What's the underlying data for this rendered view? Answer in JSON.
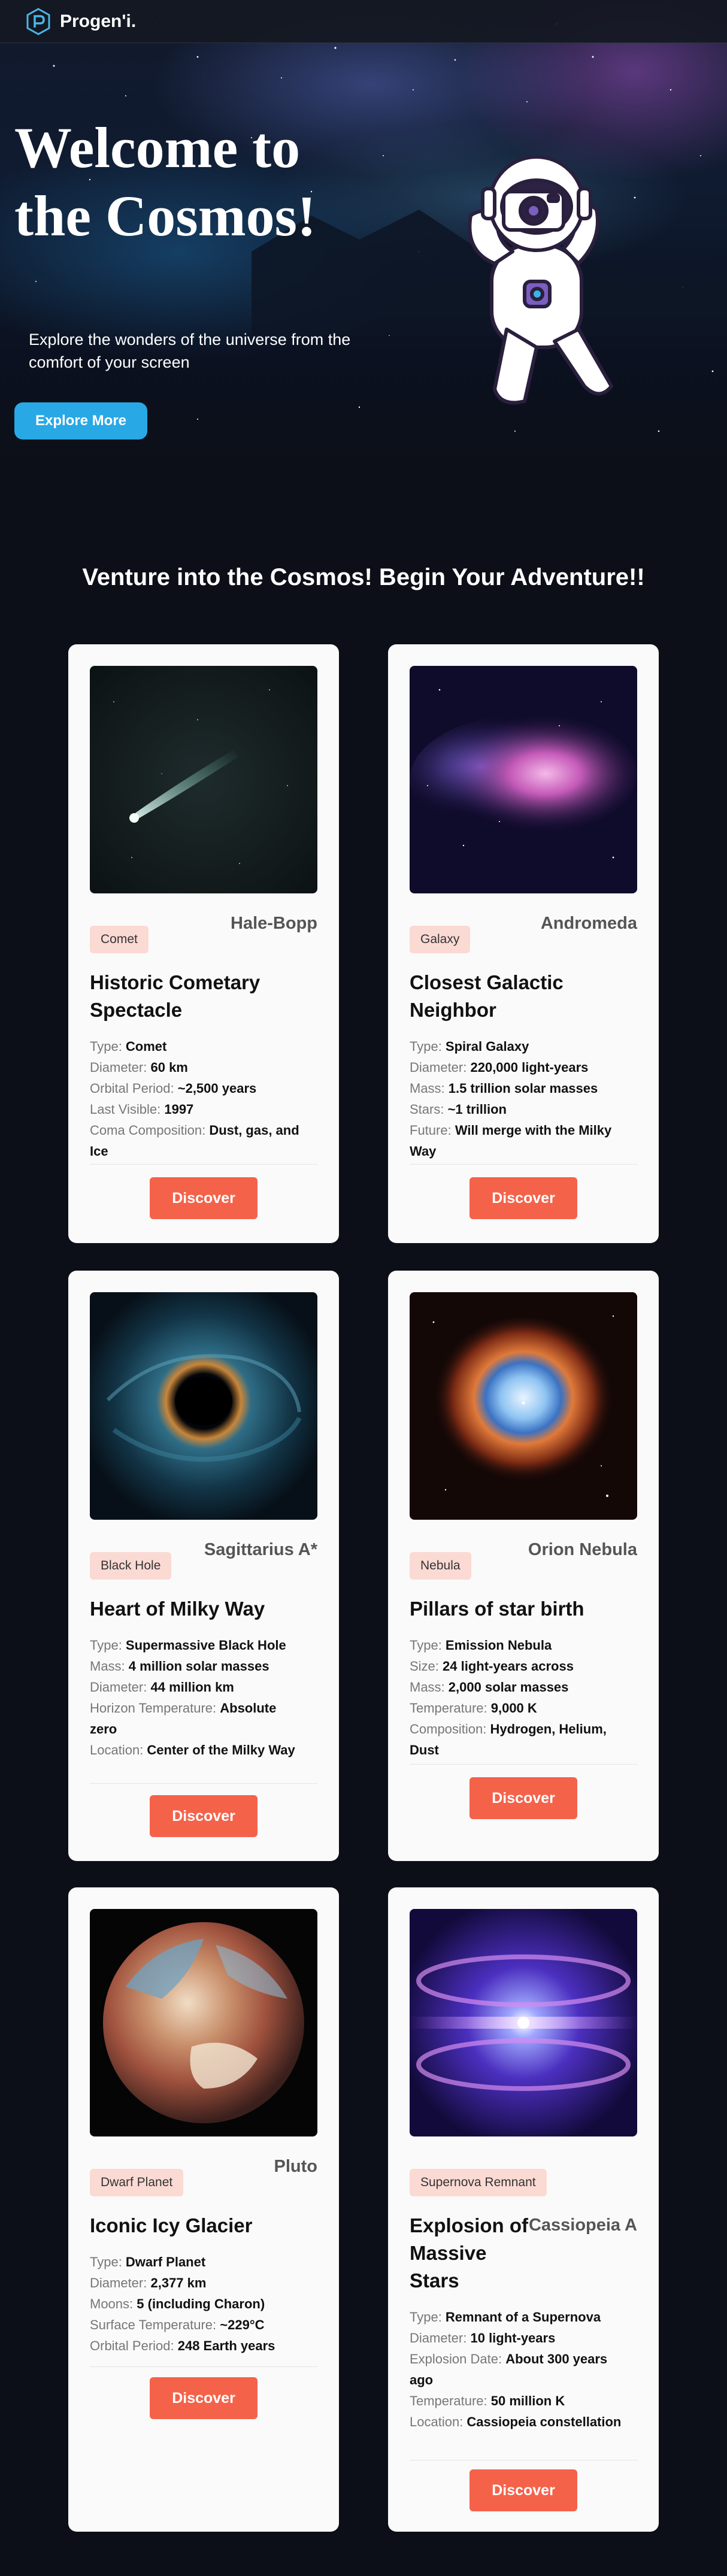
{
  "nav": {
    "logo_text": "Progen'i.",
    "logo_icon": "hexagon-p-logo-icon"
  },
  "hero": {
    "title": "Welcome to the Cosmos!",
    "subtitle": "Explore the wonders of the universe from the comfort of your screen",
    "button_label": "Explore More",
    "astronaut_icon": "astronaut-camera-illustration"
  },
  "section": {
    "title": "Venture into the Cosmos! Begin Your Adventure!!"
  },
  "colors": {
    "accent": "#f4624a",
    "hero_button": "#29a8e6",
    "badge_bg": "#fbdad4",
    "page_bg": "#0c0f17"
  },
  "cards": [
    {
      "name": "Hale-Bopp",
      "badge": "Comet",
      "title": "Historic Cometary Spectacle",
      "details": [
        {
          "label": "Type: ",
          "value": "Comet"
        },
        {
          "label": "Diameter: ",
          "value": "60 km"
        },
        {
          "label": "Orbital Period: ",
          "value": "~2,500 years"
        },
        {
          "label": "Last Visible: ",
          "value": "1997"
        },
        {
          "label": "Coma Composition: ",
          "value": "Dust, gas, and Ice"
        }
      ],
      "button": "Discover"
    },
    {
      "name": "Andromeda",
      "badge": "Galaxy",
      "title": "Closest Galactic Neighbor",
      "details": [
        {
          "label": "Type: ",
          "value": "Spiral Galaxy"
        },
        {
          "label": "Diameter: ",
          "value": "220,000 light-years"
        },
        {
          "label": "Mass: ",
          "value": "1.5 trillion solar masses"
        },
        {
          "label": "Stars: ",
          "value": "~1 trillion"
        },
        {
          "label": "Future: ",
          "value": "Will merge with the Milky Way"
        }
      ],
      "button": "Discover"
    },
    {
      "name": "Sagittarius A*",
      "badge": "Black Hole",
      "title": "Heart of Milky Way",
      "details": [
        {
          "label": "Type: ",
          "value": "Supermassive Black Hole"
        },
        {
          "label": "Mass: ",
          "value": "4 million solar masses"
        },
        {
          "label": "Diameter: ",
          "value": "44 million km"
        },
        {
          "label": "Horizon Temperature: ",
          "value": "Absolute zero"
        },
        {
          "label": "Location: ",
          "value": "Center of the Milky Way"
        }
      ],
      "button": "Discover"
    },
    {
      "name": "Orion Nebula",
      "badge": "Nebula",
      "title": "Pillars of star birth",
      "details": [
        {
          "label": "Type: ",
          "value": "Emission Nebula"
        },
        {
          "label": "Size: ",
          "value": "24 light-years across"
        },
        {
          "label": "Mass: ",
          "value": "2,000 solar masses"
        },
        {
          "label": "Temperature: ",
          "value": "9,000 K"
        },
        {
          "label": "Composition: ",
          "value": "Hydrogen, Helium, Dust"
        }
      ],
      "button": "Discover"
    },
    {
      "name": "Pluto",
      "badge": "Dwarf Planet",
      "title": "Iconic Icy Glacier",
      "details": [
        {
          "label": "Type: ",
          "value": "Dwarf Planet"
        },
        {
          "label": "Diameter: ",
          "value": "2,377 km"
        },
        {
          "label": "Moons: ",
          "value": "5 (including Charon)"
        },
        {
          "label": "Surface Temperature: ",
          "value": "~229°C"
        },
        {
          "label": "Orbital Period: ",
          "value": "248 Earth years"
        }
      ],
      "button": "Discover"
    },
    {
      "name": "Cassiopeia A",
      "badge": "Supernova Remnant",
      "title": "Explosion of Massive Stars",
      "details": [
        {
          "label": "Type: ",
          "value": "Remnant of a Supernova"
        },
        {
          "label": "Diameter: ",
          "value": "10 light-years"
        },
        {
          "label": "Explosion Date: ",
          "value": "About 300 years ago"
        },
        {
          "label": "Temperature: ",
          "value": "50 million K"
        },
        {
          "label": "Location: ",
          "value": "Cassiopeia constellation"
        }
      ],
      "button": "Discover"
    }
  ]
}
